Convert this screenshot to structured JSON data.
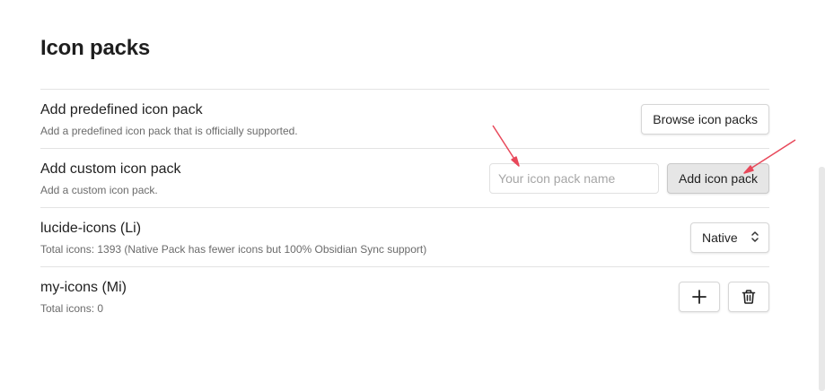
{
  "page": {
    "title": "Icon packs"
  },
  "settings": {
    "predefined": {
      "name": "Add predefined icon pack",
      "description": "Add a predefined icon pack that is officially supported.",
      "button_label": "Browse icon packs"
    },
    "custom": {
      "name": "Add custom icon pack",
      "description": "Add a custom icon pack.",
      "input_value": "",
      "input_placeholder": "Your icon pack name",
      "button_label": "Add icon pack"
    },
    "lucide": {
      "name": "lucide-icons (Li)",
      "description": "Total icons: 1393 (Native Pack has fewer icons but 100% Obsidian Sync support)",
      "selected_option": "Native"
    },
    "myicons": {
      "name": "my-icons (Mi)",
      "description": "Total icons: 0",
      "add_icon": "plus-icon",
      "delete_icon": "trash-icon"
    }
  },
  "colors": {
    "annotation_arrow": "#e8485a",
    "button_gray": "#e6e6e6"
  }
}
